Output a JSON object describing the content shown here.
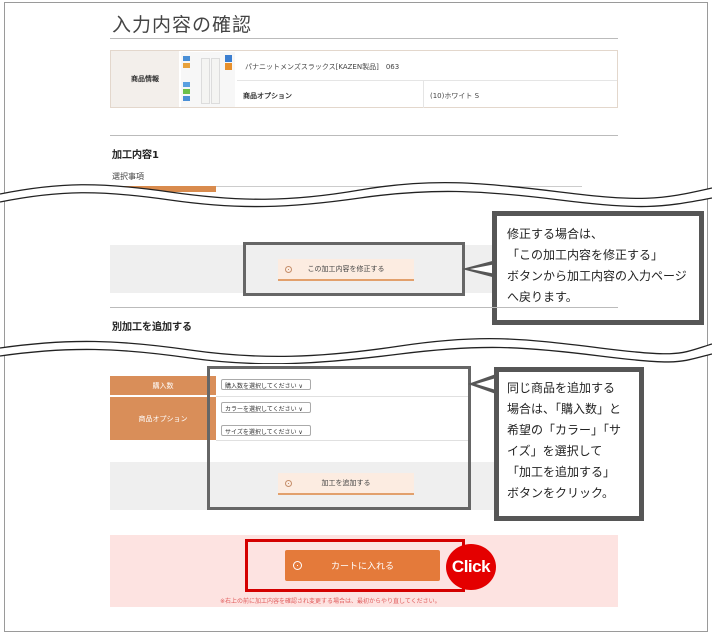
{
  "page": {
    "title": "入力内容の確認"
  },
  "product": {
    "label": "商品情報",
    "name": "パナニットメンズスラックス[KAZEN製品]　063",
    "option_label": "商品オプション",
    "option_value": "(10)ホワイト S"
  },
  "processing": {
    "title": "加工内容1",
    "subtitle": "選択事項",
    "edit_button": "この加工内容を修正する"
  },
  "add_section": {
    "title": "別加工を追加する",
    "qty_label": "購入数",
    "options_label": "商品オプション",
    "qty_select": "購入数を選択してください ∨",
    "color_select": "カラーを選択してください ∨",
    "size_select": "サイズを選択してください ∨",
    "add_button": "加工を追加する"
  },
  "cart": {
    "button": "カートに入れる",
    "note": "※右上の前に加工内容を確認され変更する場合は、最初からやり直してください。"
  },
  "annotations": {
    "callout_edit": "修正する場合は、\n「この加工内容を修正する」\nボタンから加工内容の入力ページへ戻ります。",
    "callout_add": "同じ商品を追加する\n場合は、「購入数」と\n希望の「カラー」「サ\nイズ」を選択して\n「加工を追加する」\nボタンをクリック。",
    "click_badge": "Click"
  },
  "colors": {
    "accent_orange": "#d98e59",
    "cart_orange": "#e47a3a",
    "highlight_red": "#d40000",
    "pink_bg": "#fde3e1"
  }
}
